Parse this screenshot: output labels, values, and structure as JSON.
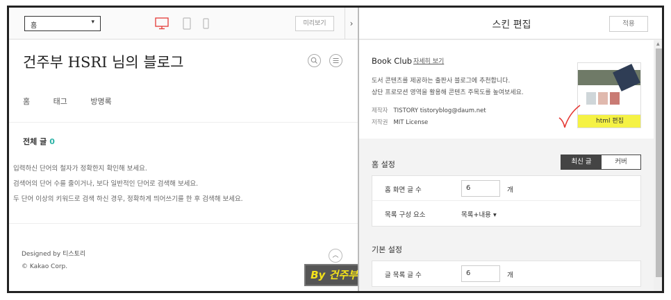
{
  "toolbar": {
    "page_select": "홈",
    "preview_label": "미리보기",
    "collapse_glyph": "›"
  },
  "blog": {
    "title": "건주부 HSRI 님의 블로그",
    "nav": [
      "홈",
      "태그",
      "방명록"
    ],
    "all_posts_label": "전체 글",
    "all_posts_count": "0",
    "messages": [
      "입력하신 단어의 철자가 정확한지 확인해 보세요.",
      "검색어의 단어 수를 줄이거나, 보다 일반적인 단어로 검색해 보세요.",
      "두 단어 이상의 키워드로 검색 하신 경우, 정확하게 띄어쓰기를 한 후 검색해 보세요."
    ],
    "footer_designed": "Designed by 티스토리",
    "footer_copyright": "© Kakao Corp."
  },
  "watermark": "By 건주부",
  "editor": {
    "title": "스킨 편집",
    "apply_label": "적용",
    "skin": {
      "name": "Book Club",
      "more_link": "자세히 보기",
      "desc_line1": "도서 콘텐츠를 제공하는 출판사 블로그에 추천합니다.",
      "desc_line2": "상단 프로모션 영역을 활용해 콘텐츠 주목도를 높여보세요.",
      "maker_key": "제작자",
      "maker_val": "TISTORY tistoryblog@daum.net",
      "license_key": "저작권",
      "license_val": "MIT License",
      "html_edit_label": "html 편집"
    },
    "home_settings": {
      "title": "홈 설정",
      "tabs": [
        "최신 글",
        "커버"
      ],
      "rows": [
        {
          "label": "홈 화면 글 수",
          "value": "6",
          "unit": "개"
        },
        {
          "label": "목록 구성 요소",
          "value": "목록+내용 ▾"
        }
      ]
    },
    "basic_settings": {
      "title": "기본 설정",
      "rows": [
        {
          "label": "글 목록 글 수",
          "value": "6",
          "unit": "개"
        }
      ]
    }
  },
  "colors": {
    "accent_count": "#2bb2a6",
    "device_active": "#e53935",
    "watermark_text": "#f4e21a",
    "highlight": "#f5f244"
  },
  "icons": [
    "chevron-down-icon",
    "desktop-icon",
    "tablet-icon",
    "mobile-icon",
    "search-icon",
    "menu-icon",
    "arrow-up-icon",
    "checkmark-annotation-icon"
  ]
}
